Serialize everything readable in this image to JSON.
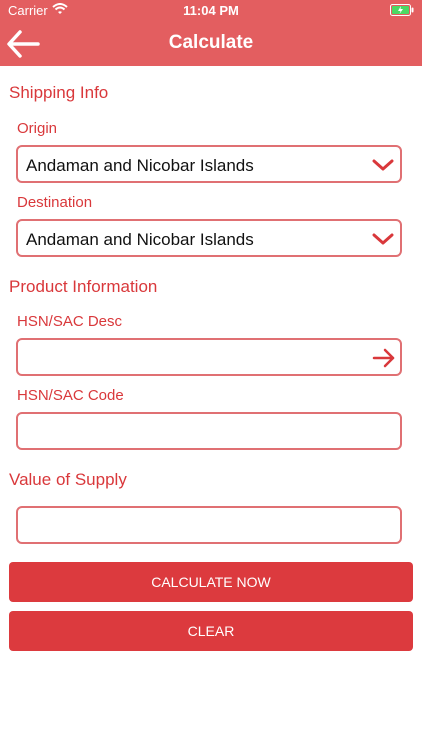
{
  "status_bar": {
    "carrier": "Carrier",
    "time": "11:04 PM"
  },
  "header": {
    "title": "Calculate"
  },
  "shipping_info": {
    "title": "Shipping Info",
    "origin_label": "Origin",
    "origin_value": "Andaman and Nicobar Islands",
    "destination_label": "Destination",
    "destination_value": "Andaman and Nicobar Islands"
  },
  "product_info": {
    "title": "Product Information",
    "hsn_desc_label": "HSN/SAC Desc",
    "hsn_desc_value": "",
    "hsn_code_label": "HSN/SAC Code",
    "hsn_code_value": ""
  },
  "value_of_supply": {
    "title": "Value of Supply",
    "value": ""
  },
  "buttons": {
    "calculate_label": "CALCULATE NOW",
    "clear_label": "CLEAR"
  },
  "colors": {
    "brand": "#e35e60",
    "accent_text": "#d9383b",
    "button": "#dc3a3e"
  }
}
